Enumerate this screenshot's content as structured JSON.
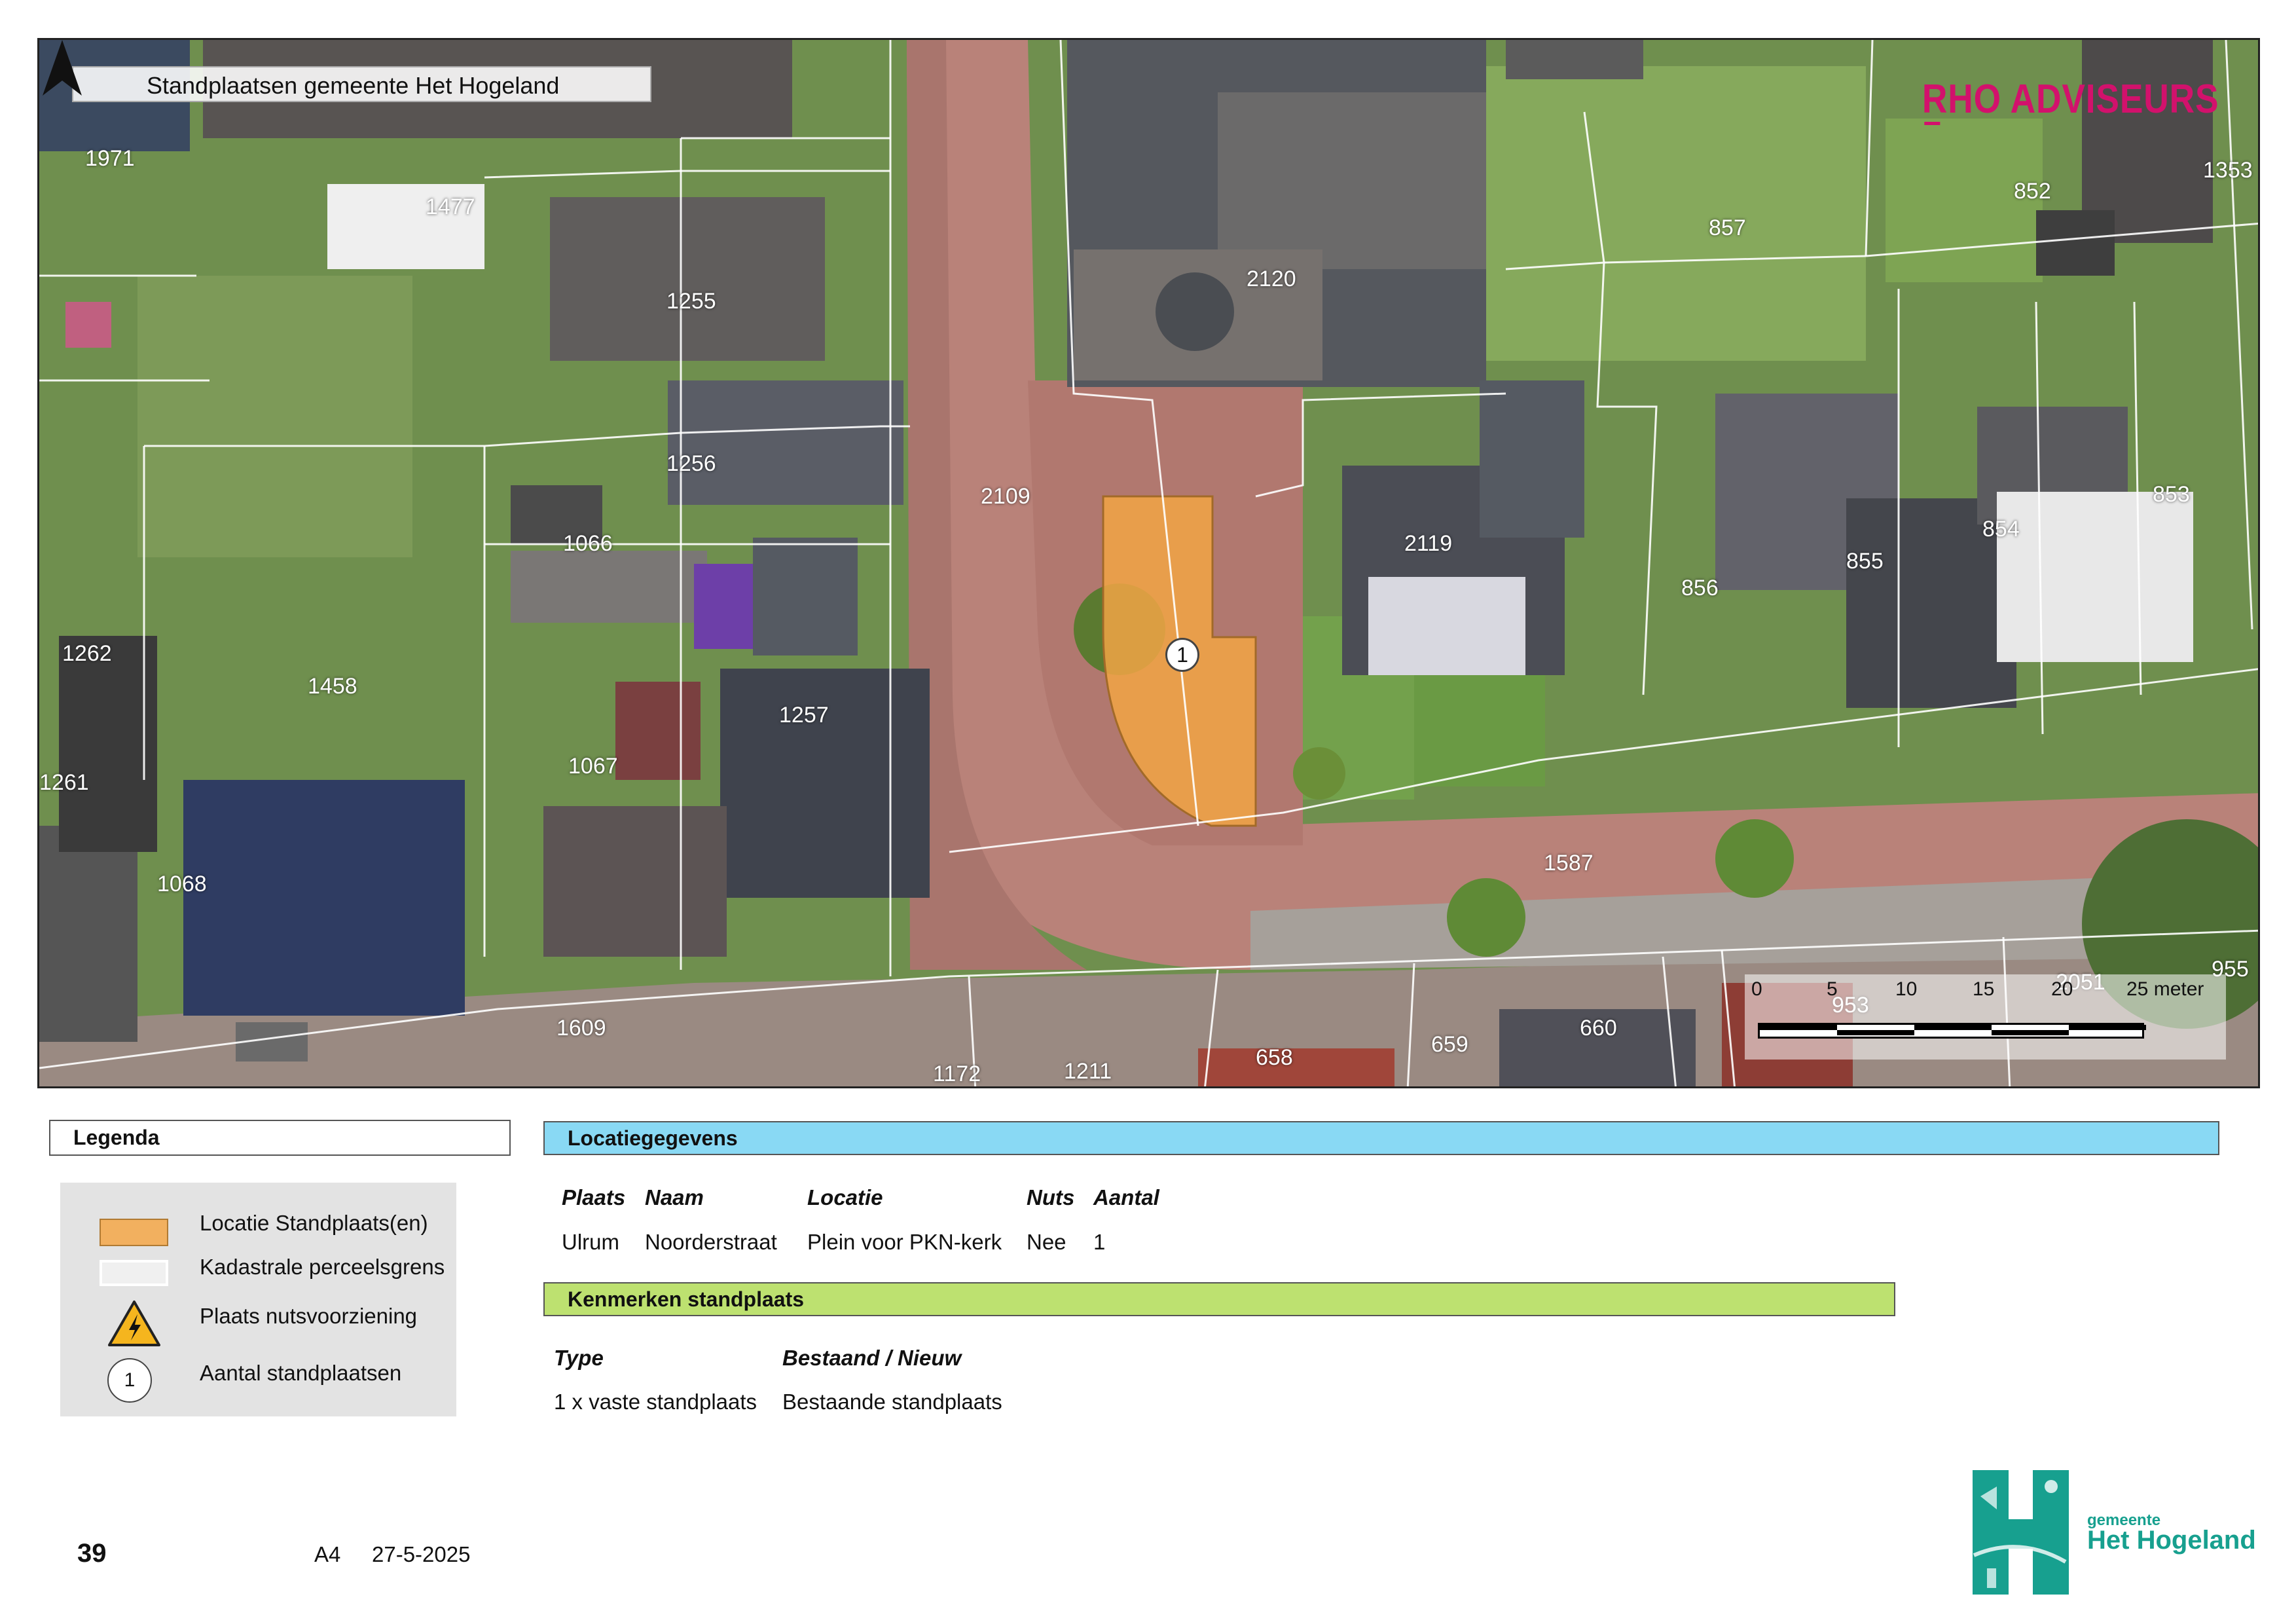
{
  "map": {
    "title": "Standplaatsen gemeente Het Hogeland",
    "brand": "RHO ADVISEURS",
    "brand_color": "#d2116c",
    "highlight_color": "#f2a545",
    "parcel_numbers": [
      "1971",
      "1477",
      "1255",
      "1256",
      "1066",
      "1262",
      "1458",
      "1261",
      "1067",
      "1257",
      "1068",
      "1609",
      "1172",
      "1211",
      "658",
      "659",
      "660",
      "2109",
      "2120",
      "2119",
      "857",
      "852",
      "1353",
      "856",
      "855",
      "854",
      "853",
      "1587",
      "953",
      "2051",
      "955"
    ],
    "marker_label": "1",
    "scale_ticks": [
      "0",
      "5",
      "10",
      "15",
      "20",
      "25 meter"
    ],
    "north_icon": "north-arrow-icon"
  },
  "legend": {
    "title": "Legenda",
    "items": [
      {
        "label": "Locatie Standplaats(en)",
        "icon": "orange-area-swatch"
      },
      {
        "label": "Kadastrale perceelsgrens",
        "icon": "parcel-boundary-swatch"
      },
      {
        "label": "Plaats nutsvoorziening",
        "icon": "lightning-warning-icon"
      },
      {
        "label": "Aantal standplaatsen",
        "icon": "numbered-circle-icon",
        "symbol": "1"
      }
    ]
  },
  "location": {
    "title": "Locatiegegevens",
    "headers": [
      "Plaats",
      "Naam",
      "Locatie",
      "Nuts",
      "Aantal"
    ],
    "row": [
      "Ulrum",
      "Noorderstraat",
      "Plein voor PKN-kerk",
      "Nee",
      "1"
    ]
  },
  "features": {
    "title": "Kenmerken standplaats",
    "headers": [
      "Type",
      "Bestaand / Nieuw"
    ],
    "row": [
      "1 x vaste standplaats",
      "Bestaande standplaats"
    ]
  },
  "footer": {
    "page": "39",
    "format": "A4",
    "date": "27-5-2025"
  },
  "municipality_logo": {
    "line1": "gemeente",
    "line2": "Het Hogeland",
    "color": "#17a08f"
  }
}
